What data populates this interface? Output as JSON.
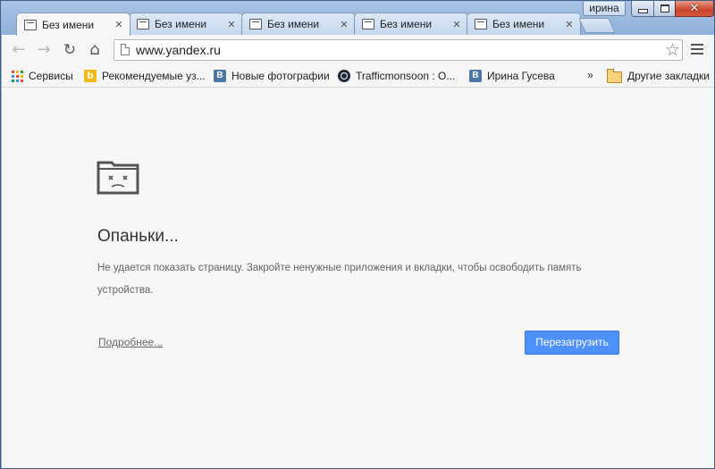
{
  "window": {
    "user_badge": "ирина",
    "close_glyph": "✕"
  },
  "tabs": [
    {
      "title": "Без имени",
      "close": "✕",
      "active": true
    },
    {
      "title": "Без имени",
      "close": "✕",
      "active": false
    },
    {
      "title": "Без имени",
      "close": "✕",
      "active": false
    },
    {
      "title": "Без имени",
      "close": "✕",
      "active": false
    },
    {
      "title": "Без имени",
      "close": "✕",
      "active": false
    }
  ],
  "toolbar": {
    "back_glyph": "←",
    "forward_glyph": "→",
    "reload_glyph": "↻",
    "home_glyph": "⌂",
    "url": "www.yandex.ru",
    "star_glyph": "☆"
  },
  "bookmarks": {
    "items": [
      {
        "label": "Сервисы",
        "icon": "apps-icon"
      },
      {
        "label": "Рекомендуемые уз...",
        "icon": "bing-icon"
      },
      {
        "label": "Новые фотографии",
        "icon": "vk-icon"
      },
      {
        "label": "Trafficmonsoon : O...",
        "icon": "trafficmonsoon-icon"
      },
      {
        "label": "Ирина Гусева",
        "icon": "vk-icon"
      }
    ],
    "chevron": "»",
    "other": "Другие закладки",
    "vk_letter": "В",
    "bing_letter": "b"
  },
  "error": {
    "title": "Опаньки...",
    "message": "Не удается показать страницу. Закройте ненужные приложения и вкладки, чтобы освободить память устройства.",
    "details_link": "Подробнее...",
    "reload_button": "Перезагрузить"
  },
  "colors": {
    "accent_button": "#4d90fe",
    "close_button": "#c7442a"
  }
}
